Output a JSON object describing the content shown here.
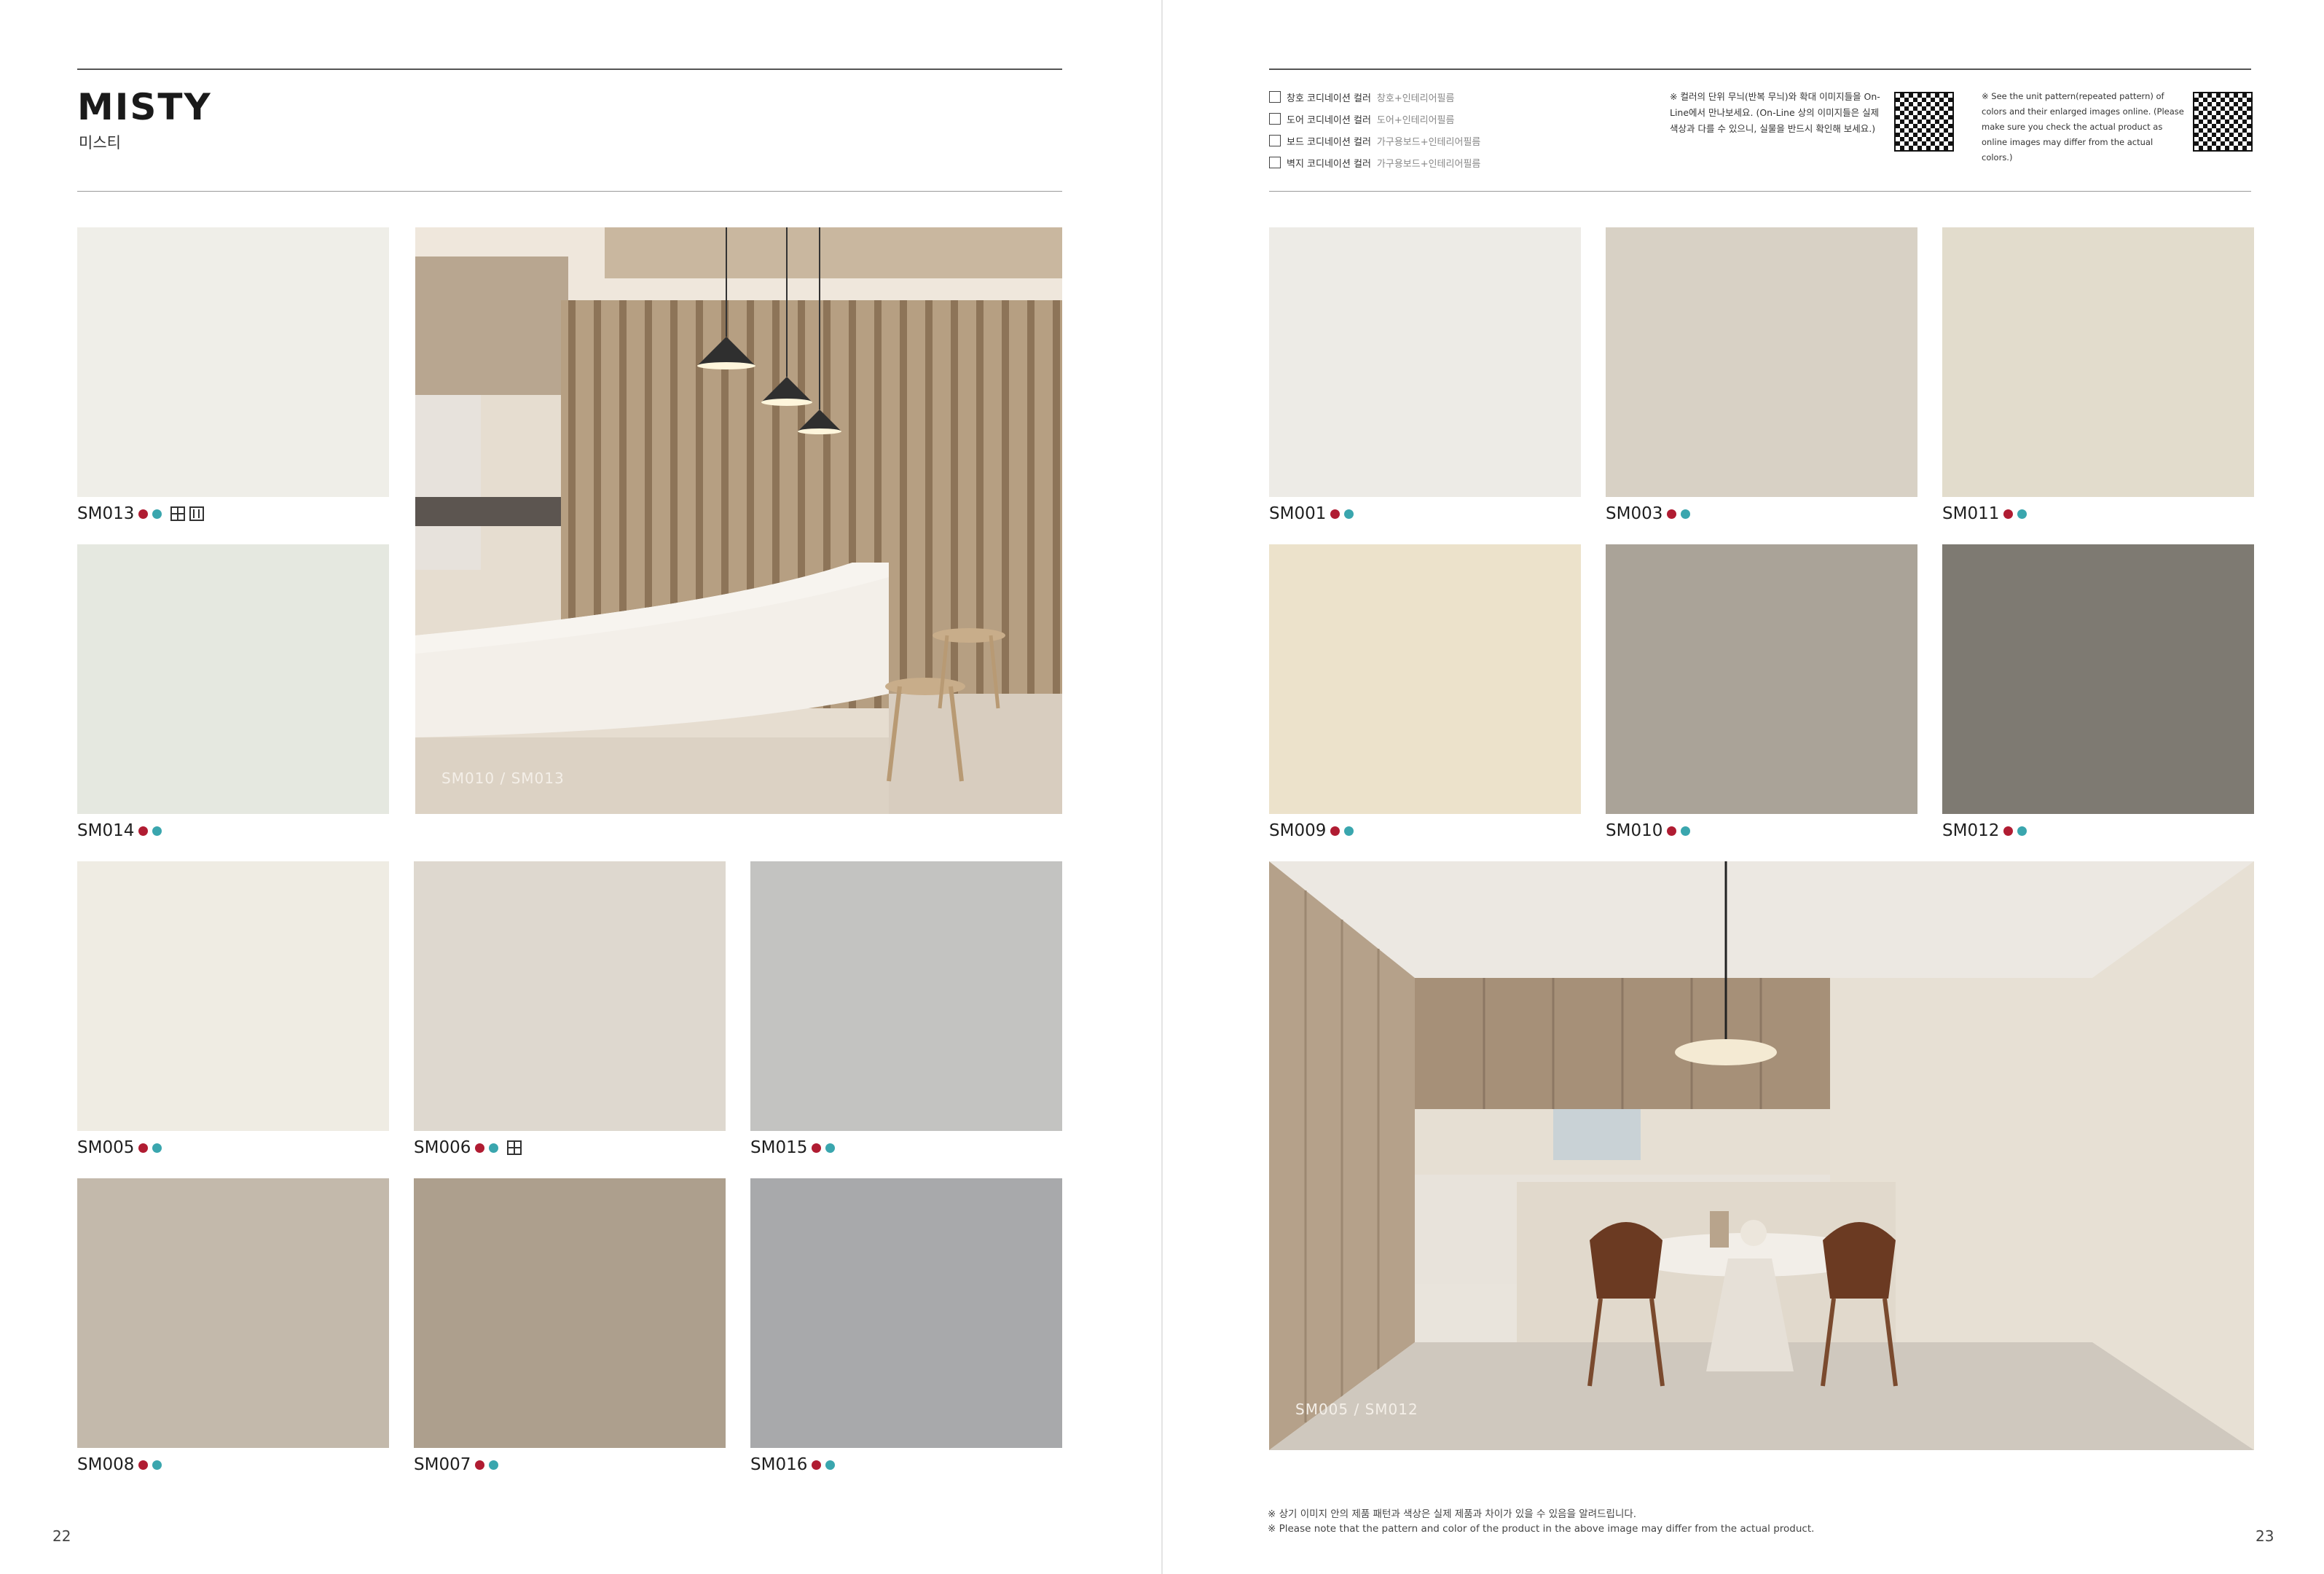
{
  "left_page": {
    "title": "MISTY",
    "subtitle": "미스티",
    "page_number": "22",
    "photo_caption": "SM010 / SM013",
    "swatches": [
      {
        "code": "SM013",
        "color": "#efeee8",
        "icons": [
          "window-icon",
          "wall-icon"
        ]
      },
      {
        "code": "SM014",
        "color": "#e5e8e0",
        "icons": []
      },
      {
        "code": "SM005",
        "color": "#efece3",
        "icons": []
      },
      {
        "code": "SM006",
        "color": "#ded8cf",
        "icons": [
          "window-icon"
        ]
      },
      {
        "code": "SM015",
        "color": "#c3c3c1",
        "icons": []
      },
      {
        "code": "SM008",
        "color": "#c3b9ab",
        "icons": []
      },
      {
        "code": "SM007",
        "color": "#ad9f8d",
        "icons": []
      },
      {
        "code": "SM016",
        "color": "#a8a9ab",
        "icons": []
      }
    ]
  },
  "right_page": {
    "page_number": "23",
    "legend": [
      {
        "label": "창호 코디네이션 컬러",
        "sub": "창호+인테리어필름"
      },
      {
        "label": "도어 코디네이션 컬러",
        "sub": "도어+인테리어필름"
      },
      {
        "label": "보드 코디네이션 컬러",
        "sub": "가구용보드+인테리어필름"
      },
      {
        "label": "벽지 코디네이션 컬러",
        "sub": "가구용보드+인테리어필름"
      }
    ],
    "note_kr": "※ 컬러의 단위 무늬(반복 무늬)와 확대 이미지들을 On-Line에서 만나보세요. (On-Line 상의 이미지들은 실제 색상과 다를 수 있으니, 실물을 반드시 확인해 보세요.)",
    "note_en": "※ See the unit pattern(repeated pattern) of colors and their enlarged images online. (Please make sure you check the actual product as online images may differ from the actual colors.)",
    "photo_caption": "SM005 / SM012",
    "swatches": [
      {
        "code": "SM001",
        "color": "#edebe6"
      },
      {
        "code": "SM003",
        "color": "#d8d1c5"
      },
      {
        "code": "SM011",
        "color": "#e2dccc"
      },
      {
        "code": "SM009",
        "color": "#ece2cb"
      },
      {
        "code": "SM010",
        "color": "#aaa398"
      },
      {
        "code": "SM012",
        "color": "#7e7a72"
      }
    ],
    "footnote_kr": "※ 상기 이미지 안의 제품 패턴과 색상은 실제 제품과 차이가 있을 수 있음을 알려드립니다.",
    "footnote_en": "※ Please note that the pattern and color of the product in the above image may differ from the actual product."
  }
}
